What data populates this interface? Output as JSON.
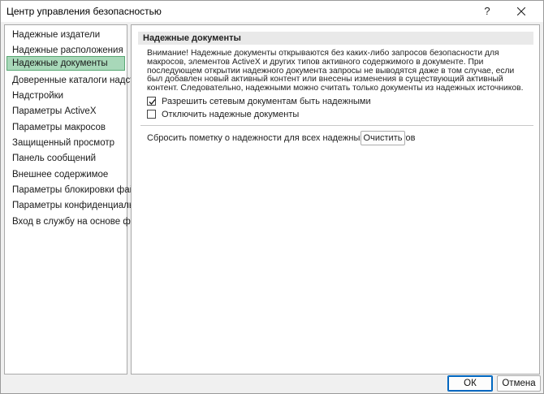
{
  "window": {
    "title": "Центр управления безопасностью",
    "help_label": "?"
  },
  "nav": {
    "items": [
      {
        "label": "Надежные издатели"
      },
      {
        "label": "Надежные расположения"
      },
      {
        "label": "Надежные документы",
        "selected": true
      },
      {
        "label": "Доверенные каталоги надстроек"
      },
      {
        "label": "Надстройки"
      },
      {
        "label": "Параметры ActiveX"
      },
      {
        "label": "Параметры макросов"
      },
      {
        "label": "Защищенный просмотр"
      },
      {
        "label": "Панель сообщений"
      },
      {
        "label": "Внешнее содержимое"
      },
      {
        "label": "Параметры блокировки файлов"
      },
      {
        "label": "Параметры конфиденциальности"
      },
      {
        "label": "Вход в службу на основе формы"
      }
    ]
  },
  "main": {
    "section_title": "Надежные документы",
    "warning": "Внимание! Надежные документы открываются без каких-либо запросов безопасности для макросов, элементов ActiveX и других типов активного содержимого в документе. При последующем открытии надежного документа запросы не выводятся даже в том случае, если был добавлен новый активный контент или внесены изменения в существующий активный контент. Следовательно, надежными можно считать только документы из надежных источников.",
    "options": [
      {
        "label": "Разрешить сетевым документам быть надежными",
        "checked": true
      },
      {
        "label": "Отключить надежные документы",
        "checked": false
      }
    ],
    "reset_text": "Сбросить пометку о надежности для всех надежных документов",
    "clear_button": "Очистить"
  },
  "footer": {
    "ok_label": "ОК",
    "cancel_label": "Отмена"
  },
  "colors": {
    "selected_bg": "#a8d8b9",
    "selected_border": "#5aa874",
    "default_button_border": "#0067c0"
  }
}
